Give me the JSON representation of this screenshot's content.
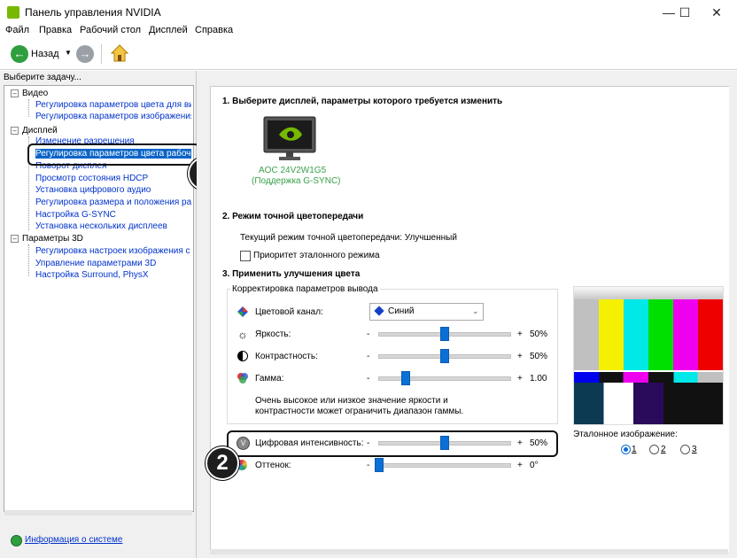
{
  "window": {
    "title": "Панель управления NVIDIA"
  },
  "menu": {
    "items": [
      "Файл",
      "Правка",
      "Рабочий стол",
      "Дисплей",
      "Справка"
    ]
  },
  "toolbar": {
    "back_label": "Назад"
  },
  "left": {
    "header": "Выберите задачу...",
    "categories": {
      "video": "Видео",
      "display": "Дисплей",
      "params3d": "Параметры 3D"
    },
    "video_items": [
      "Регулировка параметров цвета для вид",
      "Регулировка параметров изображения д"
    ],
    "display_items": [
      "Изменение разрешения",
      "Регулировка параметров цвета рабочег",
      "Поворот дисплея",
      "Просмотр состояния HDCP",
      "Установка цифрового аудио",
      "Регулировка размера и положения рабоч",
      "Настройка G-SYNC",
      "Установка нескольких дисплеев"
    ],
    "params3d_items": [
      "Регулировка настроек изображения с пр",
      "Управление параметрами 3D",
      "Настройка Surround, PhysX"
    ],
    "system_info": "Информация о системе"
  },
  "main": {
    "section1_title": "1. Выберите дисплей, параметры которого требуется изменить",
    "monitor_name": "AOC 24V2W1G5",
    "monitor_sub": "(Поддержка G-SYNC)",
    "section2_title": "2. Режим точной цветопередачи",
    "current_mode": "Текущий режим точной цветопередачи: Улучшенный",
    "ref_mode_label": "Приоритет эталонного режима",
    "section3_title": "3. Применить улучшения цвета",
    "group_label": "Корректировка параметров вывода",
    "channel_label": "Цветовой канал:",
    "channel_value": "Синий",
    "brightness_label": "Яркость:",
    "brightness_value": "50%",
    "brightness_fraction": 0.5,
    "contrast_label": "Контрастность:",
    "contrast_value": "50%",
    "contrast_fraction": 0.5,
    "gamma_label": "Гамма:",
    "gamma_value": "1.00",
    "gamma_fraction": 0.2,
    "note": "Очень высокое или низкое значение яркости и контрастности может ограничить диапазон гаммы.",
    "digital_label": "Цифровая интенсивность:",
    "digital_value": "50%",
    "digital_fraction": 0.5,
    "hue_label": "Оттенок:",
    "hue_value": "0°",
    "hue_fraction": 0.0,
    "minus": "-",
    "plus": "+",
    "ref_image_label": "Эталонное изображение:",
    "radio_options": [
      "1",
      "2",
      "3"
    ],
    "selected_radio": "1"
  },
  "callouts": {
    "one": "1",
    "two": "2"
  },
  "colors": {
    "accent": "#0b6fd6",
    "nvidia_green": "#76b900",
    "link": "#0033cc"
  }
}
